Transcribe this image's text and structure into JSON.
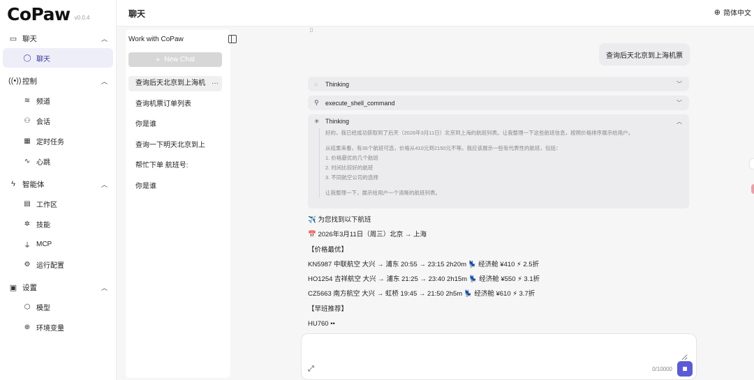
{
  "app": {
    "logo": "CoPaw",
    "version": "v0.0.4"
  },
  "header": {
    "title": "聊天",
    "language": "简体中文"
  },
  "sidebar": {
    "groups": [
      {
        "label": "聊天",
        "icon": "chat-icon",
        "items": [
          {
            "label": "聊天",
            "icon": "chat-bubble-icon",
            "active": true
          }
        ]
      },
      {
        "label": "控制",
        "icon": "broadcast-icon",
        "items": [
          {
            "label": "频道",
            "icon": "wifi-icon"
          },
          {
            "label": "会话",
            "icon": "users-icon"
          },
          {
            "label": "定时任务",
            "icon": "calendar-icon"
          },
          {
            "label": "心跳",
            "icon": "pulse-icon"
          }
        ]
      },
      {
        "label": "智能体",
        "icon": "lightning-icon",
        "items": [
          {
            "label": "工作区",
            "icon": "briefcase-icon"
          },
          {
            "label": "技能",
            "icon": "sparkles-icon"
          },
          {
            "label": "MCP",
            "icon": "plug-icon"
          },
          {
            "label": "运行配置",
            "icon": "gear-icon"
          }
        ]
      },
      {
        "label": "设置",
        "icon": "chip-icon",
        "items": [
          {
            "label": "模型",
            "icon": "cube-icon"
          },
          {
            "label": "环境变量",
            "icon": "globe-icon"
          }
        ]
      }
    ]
  },
  "chatlist": {
    "title": "Work with CoPaw",
    "new_chat": "New Chat",
    "sessions": [
      "查询后天北京到上海机",
      "查询机票订单列表",
      "你是谁",
      "查询一下明天北京到上",
      "帮忙下单 航班号:",
      "你是谁"
    ]
  },
  "conversation": {
    "user_message": "查询后天北京到上海机票",
    "tool_rows": [
      {
        "label": "Thinking",
        "icon": "bulb-icon"
      },
      {
        "label": "execute_shell_command",
        "icon": "wrench-icon"
      }
    ],
    "thinking_expanded": {
      "label": "Thinking",
      "lines": [
        "好的，我已经成功获取到了后天（2026年3月11日）北京到上海的航班列表。让我整理一下这些航班信息，按照价格排序展示给用户。",
        "",
        "从结果来看，有36个航班可选，价格从410元到2150元不等。我应该展示一些有代表性的航班，包括：",
        "1. 价格最优的几个航班",
        "2. 时间比较好的航班",
        "3. 不同航空公司的选择",
        "",
        "让我整理一下，展示给用户一个清晰的航班列表。"
      ]
    },
    "answer_lines": [
      "✈️ 为您找到以下航班",
      "📅 2026年3月11日（周三）北京 → 上海",
      "【价格最优】",
      "KN5987 中联航空 大兴 → 浦东 20:55 → 23:15 2h20m 💺 经济舱 ¥410 ⚡ 2.5折",
      "HO1254 吉祥航空 大兴 → 浦东 21:25 → 23:40 2h15m 💺 经济舱 ¥550 ⚡ 3.1折",
      "CZ5663 南方航空 大兴 → 虹桥 19:45 → 21:50 2h5m 💺 经济舱 ¥610 ⚡ 3.7折",
      "【早班推荐】",
      "HU760 ••"
    ]
  },
  "input": {
    "placeholder": "",
    "char_count": "0/10000"
  },
  "colors": {
    "accent": "#5b5bd6",
    "active_bg": "#eeeef9"
  }
}
